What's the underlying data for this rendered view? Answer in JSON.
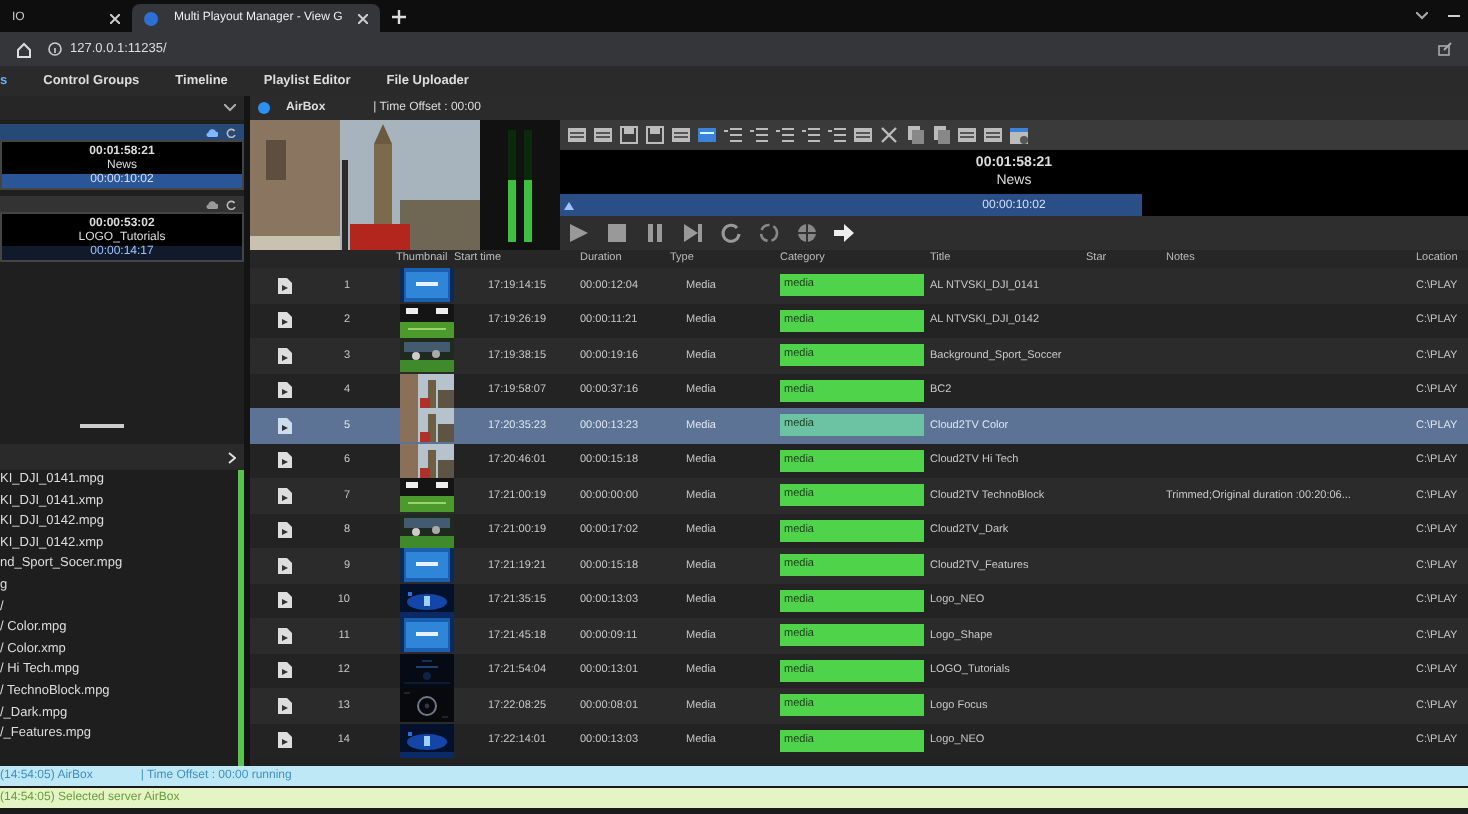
{
  "browser": {
    "tabs": [
      {
        "title": "IO",
        "selected": false
      },
      {
        "title": "Multi Playout Manager - View G",
        "selected": true
      }
    ],
    "address": "127.0.0.1:11235/"
  },
  "app_nav": [
    {
      "label": "s",
      "selected": true
    },
    {
      "label": "Control Groups",
      "selected": false
    },
    {
      "label": "Timeline",
      "selected": false
    },
    {
      "label": "Playlist Editor",
      "selected": false
    },
    {
      "label": "File Uploader",
      "selected": false
    }
  ],
  "channels": [
    {
      "time": "00:01:58:21",
      "clip": "News",
      "remaining": "00:00:10:02",
      "active": true
    },
    {
      "time": "00:00:53:02",
      "clip": "LOGO_Tutorials",
      "remaining": "00:00:14:17",
      "active": false
    }
  ],
  "files": [
    "KI_DJI_0141.mpg",
    "KI_DJI_0141.xmp",
    "KI_DJI_0142.mpg",
    "KI_DJI_0142.xmp",
    "nd_Sport_Socer.mpg",
    "g",
    "/",
    "/ Color.mpg",
    "/ Color.xmp",
    "/ Hi Tech.mpg",
    "/ TechnoBlock.mpg",
    "/_Dark.mpg",
    "/_Features.mpg"
  ],
  "player": {
    "server": "AirBox",
    "time_offset": "| Time Offset : 00:00",
    "timecode": "00:01:58:21",
    "clip": "News",
    "remaining": "00:00:10:02",
    "level": 0.64,
    "meters": [
      {
        "level": 0.55
      },
      {
        "level": 0.55
      }
    ]
  },
  "table": {
    "columns": [
      "Thumbnail",
      "Start time",
      "Duration",
      "Type",
      "Category",
      "Title",
      "Star",
      "Notes",
      "Location"
    ],
    "rows": [
      {
        "index": "1",
        "start": "17:19:14:15",
        "duration": "00:00:12:04",
        "type": "Media",
        "category": "media",
        "title": "AL NTVSKI_DJI_0141",
        "location": "C:\\PLAY",
        "selected": false
      },
      {
        "index": "2",
        "start": "17:19:26:19",
        "duration": "00:00:11:21",
        "type": "Media",
        "category": "media",
        "title": "AL NTVSKI_DJI_0142",
        "location": "C:\\PLAY",
        "selected": false
      },
      {
        "index": "3",
        "start": "17:19:38:15",
        "duration": "00:00:19:16",
        "type": "Media",
        "category": "media",
        "title": "Background_Sport_Soccer",
        "location": "C:\\PLAY",
        "selected": false
      },
      {
        "index": "4",
        "start": "17:19:58:07",
        "duration": "00:00:37:16",
        "type": "Media",
        "category": "media",
        "title": "BC2",
        "location": "C:\\PLAY",
        "selected": false
      },
      {
        "index": "5",
        "start": "17:20:35:23",
        "duration": "00:00:13:23",
        "type": "Media",
        "category": "media",
        "title": "Cloud2TV Color",
        "location": "C:\\PLAY",
        "selected": true
      },
      {
        "index": "6",
        "start": "17:20:46:01",
        "duration": "00:00:15:18",
        "type": "Media",
        "category": "media",
        "title": "Cloud2TV Hi Tech",
        "location": "C:\\PLAY",
        "selected": false
      },
      {
        "index": "7",
        "start": "17:21:00:19",
        "duration": "00:00:00:00",
        "type": "Media",
        "category": "media",
        "title": "Cloud2TV TechnoBlock",
        "notes": "Trimmed;Original duration :00:20:06...",
        "location": "C:\\PLAY",
        "selected": false
      },
      {
        "index": "8",
        "start": "17:21:00:19",
        "duration": "00:00:17:02",
        "type": "Media",
        "category": "media",
        "title": "Cloud2TV_Dark",
        "location": "C:\\PLAY",
        "selected": false
      },
      {
        "index": "9",
        "start": "17:21:19:21",
        "duration": "00:00:15:18",
        "type": "Media",
        "category": "media",
        "title": "Cloud2TV_Features",
        "location": "C:\\PLAY",
        "selected": false
      },
      {
        "index": "10",
        "start": "17:21:35:15",
        "duration": "00:00:13:03",
        "type": "Media",
        "category": "media",
        "title": "Logo_NEO",
        "location": "C:\\PLAY",
        "selected": false
      },
      {
        "index": "11",
        "start": "17:21:45:18",
        "duration": "00:00:09:11",
        "type": "Media",
        "category": "media",
        "title": "Logo_Shape",
        "location": "C:\\PLAY",
        "selected": false
      },
      {
        "index": "12",
        "start": "17:21:54:04",
        "duration": "00:00:13:01",
        "type": "Media",
        "category": "media",
        "title": "LOGO_Tutorials",
        "location": "C:\\PLAY",
        "selected": false
      },
      {
        "index": "13",
        "start": "17:22:08:25",
        "duration": "00:00:08:01",
        "type": "Media",
        "category": "media",
        "title": "Logo Focus",
        "location": "C:\\PLAY",
        "selected": false
      },
      {
        "index": "14",
        "start": "17:22:14:01",
        "duration": "00:00:13:03",
        "type": "Media",
        "category": "media",
        "title": "Logo_NEO",
        "location": "C:\\PLAY",
        "selected": false
      }
    ]
  },
  "status": [
    {
      "kind": "info",
      "text": "(14:54:05) AirBox",
      "extra": "| Time Offset : 00:00 running"
    },
    {
      "kind": "success",
      "text": "(14:54:05) Selected server AirBox"
    }
  ]
}
